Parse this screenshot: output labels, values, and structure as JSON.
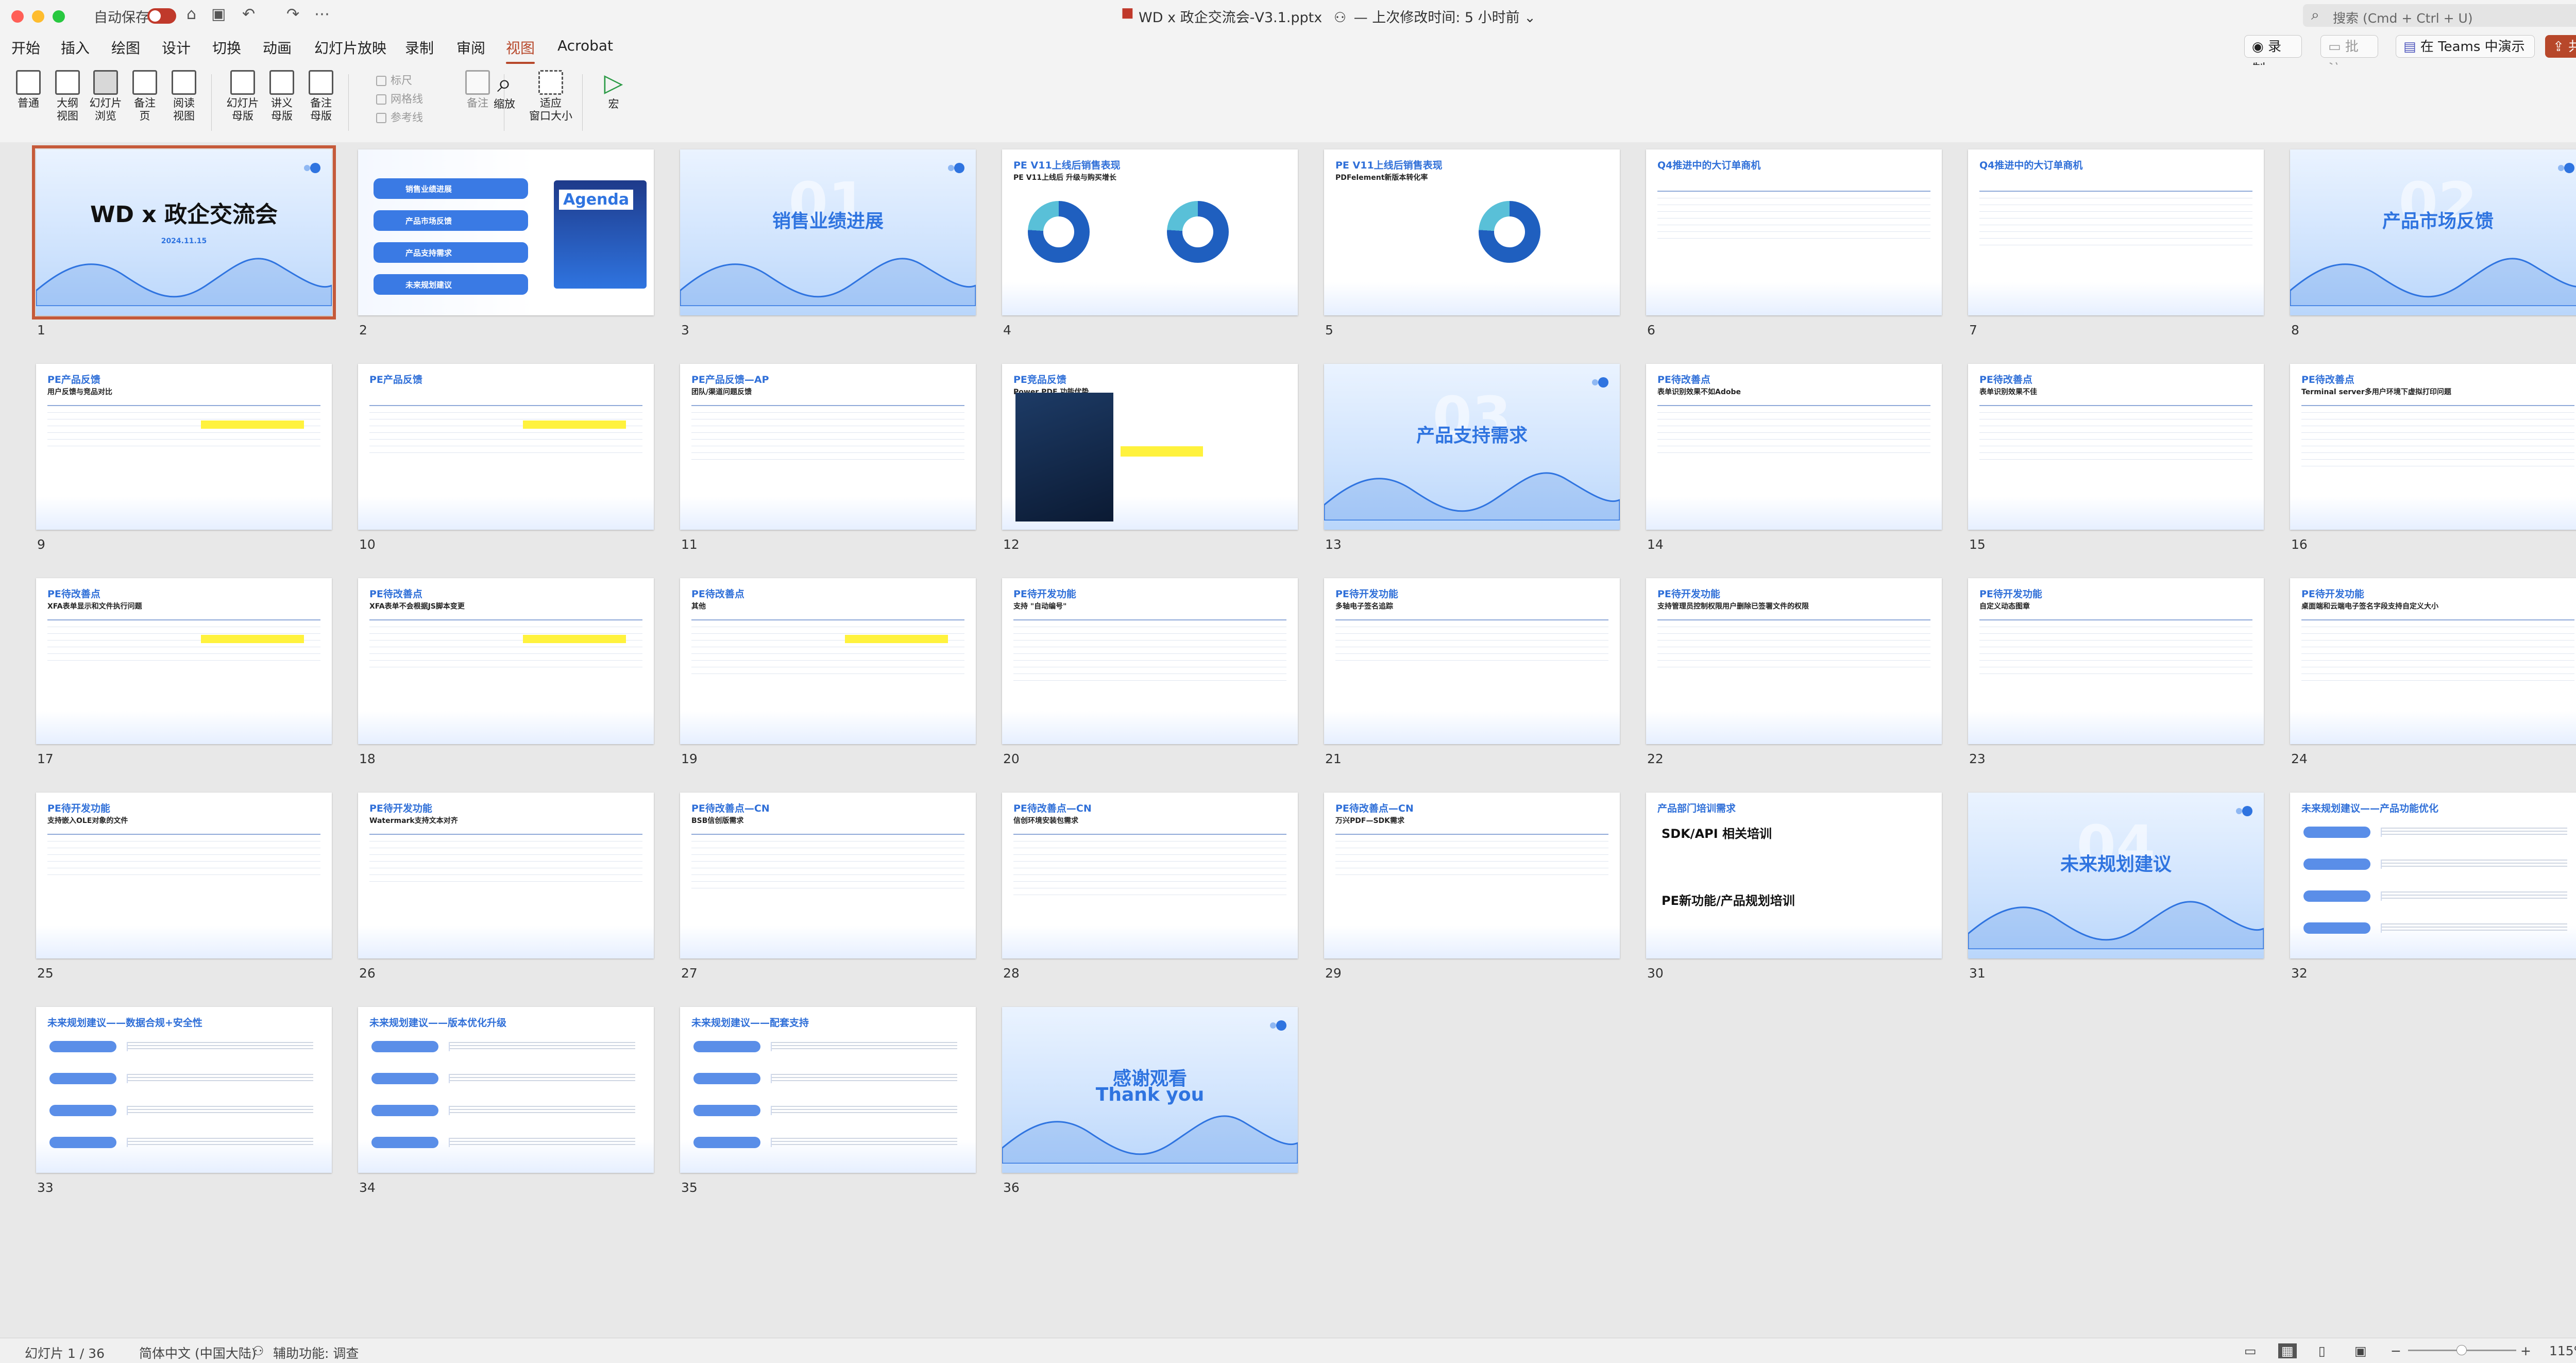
{
  "titlebar": {
    "autosave_label": "自动保存",
    "doc_title": "WD x 政企交流会-V3.1.pptx",
    "modified": "— 上次修改时间: 5 小时前",
    "search_placeholder": "搜索 (Cmd + Ctrl + U)"
  },
  "tabs": [
    "开始",
    "插入",
    "绘图",
    "设计",
    "切换",
    "动画",
    "幻灯片放映",
    "录制",
    "审阅",
    "视图",
    "Acrobat"
  ],
  "active_tab": "视图",
  "tab_buttons": {
    "record": "录制",
    "comment": "批注",
    "teams": "在 Teams 中演示",
    "share": "共享"
  },
  "ribbon": {
    "normal": "普通",
    "outline": "大纲\n视图",
    "sorter": "幻灯片\n浏览",
    "notes_page": "备注\n页",
    "reading": "阅读\n视图",
    "slide_master": "幻灯片\n母版",
    "handout_master": "讲义\n母版",
    "notes_master": "备注\n母版",
    "ruler": "标尺",
    "gridlines": "网格线",
    "guides": "参考线",
    "notes": "备注",
    "zoom": "缩放",
    "fit": "适应\n窗口大小",
    "macro": "宏"
  },
  "slides": [
    {
      "n": "1",
      "title": "WD x 政企交流会",
      "sub": "2024.11.15"
    },
    {
      "n": "2",
      "title": "Agenda",
      "items": [
        "销售业绩进展",
        "产品市场反馈",
        "产品支持需求",
        "未来规划建议"
      ]
    },
    {
      "n": "3",
      "title": "销售业绩进展",
      "bg": "01"
    },
    {
      "n": "4",
      "title": "PE V11上线后销售表现",
      "sub": "PE V11上线后 升级与购买增长"
    },
    {
      "n": "5",
      "title": "PE V11上线后销售表现",
      "sub": "PDFelement新版本转化率"
    },
    {
      "n": "6",
      "title": "Q4推进中的大订单商机"
    },
    {
      "n": "7",
      "title": "Q4推进中的大订单商机"
    },
    {
      "n": "8",
      "title": "产品市场反馈",
      "bg": "02"
    },
    {
      "n": "9",
      "title": "PE产品反馈",
      "sub": "用户反馈与竞品对比"
    },
    {
      "n": "10",
      "title": "PE产品反馈"
    },
    {
      "n": "11",
      "title": "PE产品反馈—AP",
      "sub": "团队/渠道问题反馈"
    },
    {
      "n": "12",
      "title": "PE竞品反馈",
      "sub": "Power PDF 功能优势"
    },
    {
      "n": "13",
      "title": "产品支持需求",
      "bg": "03"
    },
    {
      "n": "14",
      "title": "PE待改善点",
      "sub": "表单识别效果不如Adobe"
    },
    {
      "n": "15",
      "title": "PE待改善点",
      "sub": "表单识别效果不佳"
    },
    {
      "n": "16",
      "title": "PE待改善点",
      "sub": "Terminal server多用户环境下虚拟打印问题"
    },
    {
      "n": "17",
      "title": "PE待改善点",
      "sub": "XFA表单显示和文件执行问题"
    },
    {
      "n": "18",
      "title": "PE待改善点",
      "sub": "XFA表单不会根据JS脚本变更"
    },
    {
      "n": "19",
      "title": "PE待改善点",
      "sub": "其他"
    },
    {
      "n": "20",
      "title": "PE待开发功能",
      "sub": "支持 \"自动编号\""
    },
    {
      "n": "21",
      "title": "PE待开发功能",
      "sub": "多轴电子签名追踪"
    },
    {
      "n": "22",
      "title": "PE待开发功能",
      "sub": "支持管理员控制权限用户删除已签署文件的权限"
    },
    {
      "n": "23",
      "title": "PE待开发功能",
      "sub": "自定义动态图章"
    },
    {
      "n": "24",
      "title": "PE待开发功能",
      "sub": "桌面端和云端电子签名字段支持自定义大小"
    },
    {
      "n": "25",
      "title": "PE待开发功能",
      "sub": "支持嵌入OLE对象的文件"
    },
    {
      "n": "26",
      "title": "PE待开发功能",
      "sub": "Watermark支持文本对齐"
    },
    {
      "n": "27",
      "title": "PE待改善点—CN",
      "sub": "BSB信创版需求"
    },
    {
      "n": "28",
      "title": "PE待改善点—CN",
      "sub": "信创环境安装包需求"
    },
    {
      "n": "29",
      "title": "PE待改善点—CN",
      "sub": "万兴PDF—SDK需求"
    },
    {
      "n": "30",
      "title": "产品部门培训需求",
      "h1": "SDK/API 相关培训",
      "h2": "PE新功能/产品规划培训"
    },
    {
      "n": "31",
      "title": "未来规划建议",
      "bg": "04"
    },
    {
      "n": "32",
      "title": "未来规划建议——产品功能优化"
    },
    {
      "n": "33",
      "title": "未来规划建议——数据合规+安全性"
    },
    {
      "n": "34",
      "title": "未来规划建议——版本优化升级"
    },
    {
      "n": "35",
      "title": "未来规划建议——配套支持"
    },
    {
      "n": "36",
      "title": "感谢观看",
      "sub": "Thank you"
    }
  ],
  "status": {
    "slide_counter": "幻灯片 1 / 36",
    "language": "简体中文 (中国大陆)",
    "accessibility": "辅助功能: 调查",
    "zoom": "115%"
  }
}
